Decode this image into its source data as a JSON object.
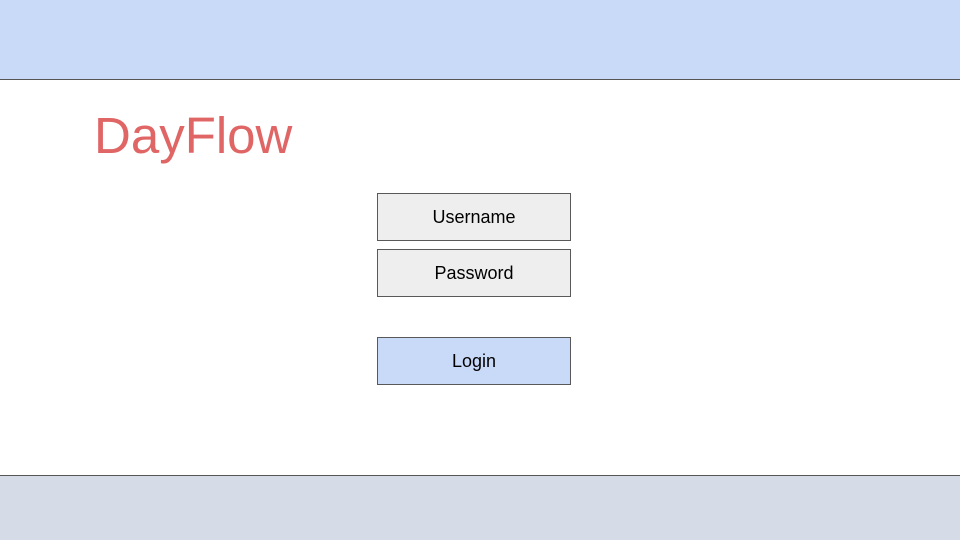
{
  "app": {
    "title": "DayFlow"
  },
  "login_form": {
    "username_placeholder": "Username",
    "password_placeholder": "Password",
    "login_label": "Login"
  },
  "colors": {
    "header_bg": "#c9daf8",
    "footer_bg": "#d5dce8",
    "title": "#e06666",
    "field_bg": "#eeeeee",
    "login_bg": "#c9daf8"
  }
}
